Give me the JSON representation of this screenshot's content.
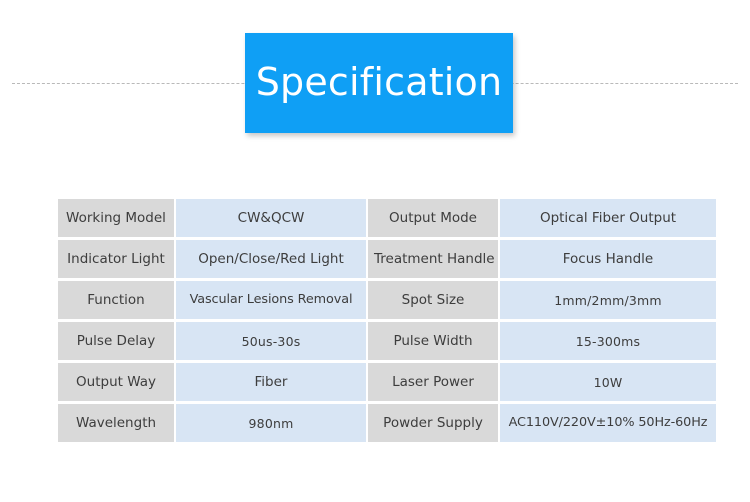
{
  "banner": {
    "title": "Specification",
    "background_color": "#0f9ff5",
    "text_color": "#ffffff"
  },
  "divider": {
    "style": "dashed",
    "color": "#b9b9b9"
  },
  "table": {
    "label_cell_color": "#d9d9d9",
    "value_cell_color": "#d8e5f4",
    "rows": [
      {
        "label_left": "Working Model",
        "value_left": "CW&QCW",
        "label_right": "Output Mode",
        "value_right": "Optical Fiber Output"
      },
      {
        "label_left": "Indicator Light",
        "value_left": "Open/Close/Red Light",
        "label_right": "Treatment Handle",
        "value_right": "Focus Handle"
      },
      {
        "label_left": "Function",
        "value_left": "Vascular Lesions Removal",
        "label_right": "Spot Size",
        "value_right": "1mm/2mm/3mm"
      },
      {
        "label_left": "Pulse Delay",
        "value_left": "50us-30s",
        "label_right": "Pulse Width",
        "value_right": "15-300ms"
      },
      {
        "label_left": "Output Way",
        "value_left": "Fiber",
        "label_right": "Laser Power",
        "value_right": "10W"
      },
      {
        "label_left": "Wavelength",
        "value_left": "980nm",
        "label_right": "Powder Supply",
        "value_right": "AC110V/220V±10% 50Hz-60Hz"
      }
    ]
  }
}
